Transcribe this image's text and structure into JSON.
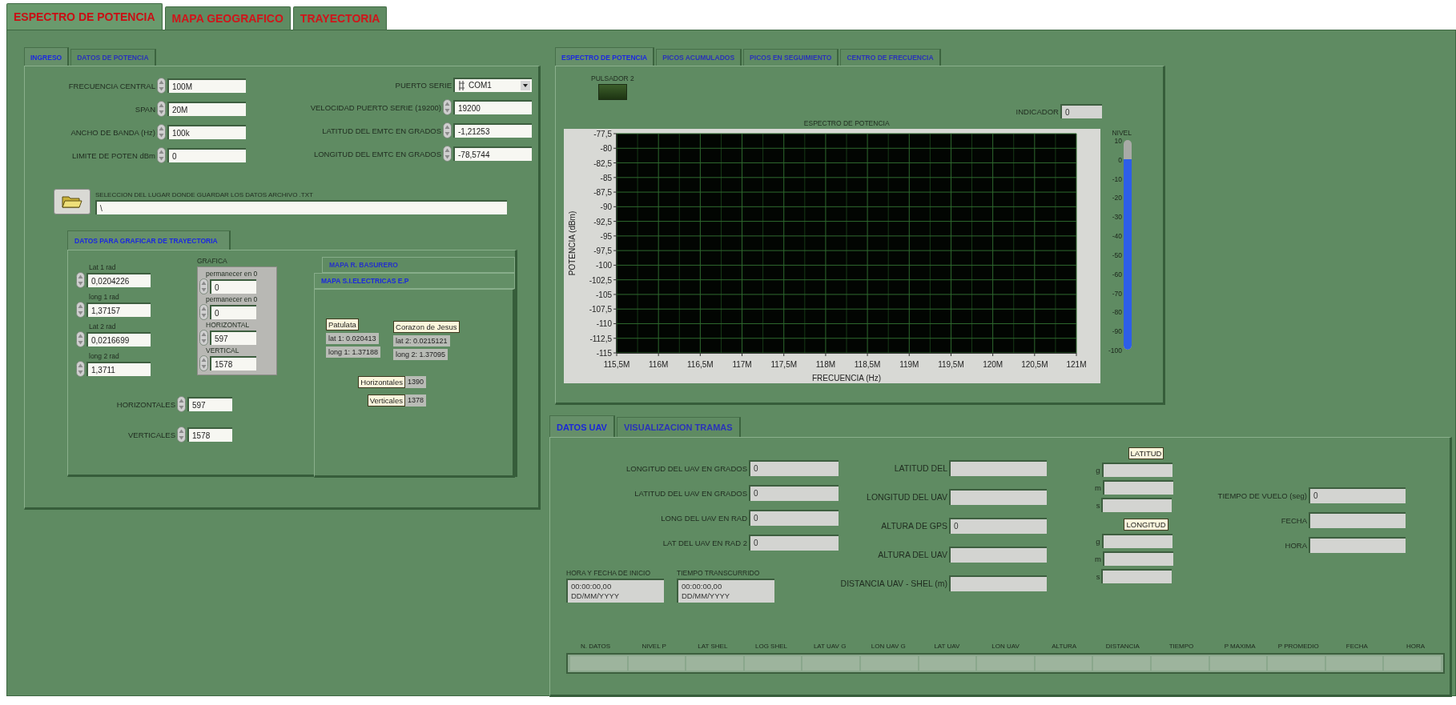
{
  "main_tabs": [
    {
      "label": "ESPECTRO DE POTENCIA",
      "selected": true
    },
    {
      "label": "MAPA GEOGRAFICO",
      "selected": false
    },
    {
      "label": "TRAYECTORIA",
      "selected": false
    }
  ],
  "input_panel": {
    "tabs": [
      {
        "label": "INGRESO",
        "selected": true
      },
      {
        "label": "DATOS DE POTENCIA",
        "selected": false
      }
    ],
    "left_fields": [
      {
        "kind": "control",
        "label": "FRECUENCIA CENTRAL",
        "value": "100M"
      },
      {
        "kind": "control",
        "label": "SPAN",
        "value": "20M"
      },
      {
        "kind": "control",
        "label": "ANCHO DE BANDA (Hz)",
        "value": "100k"
      },
      {
        "kind": "control",
        "label": "LIMITE DE POTEN dBm",
        "value": "0"
      }
    ],
    "right_fields": [
      {
        "kind": "dropdown",
        "label": "PUERTO SERIE",
        "value": "COM1"
      },
      {
        "kind": "control",
        "label": "VELOCIDAD PUERTO SERIE (19200)",
        "value": "19200"
      },
      {
        "kind": "control",
        "label": "LATITUD DEL EMTC EN GRADOS",
        "value": "-1,21253"
      },
      {
        "kind": "control",
        "label": "LONGITUD DEL EMTC EN GRADOS",
        "value": "-78,5744"
      }
    ],
    "path": {
      "label": "SELECCION DEL LUGAR DONDE  GUARDAR LOS DATOS ARCHIVO .TXT",
      "value": "\\"
    },
    "trajectory": {
      "tabs": [
        {
          "label": "DATOS PARA GRAFICAR DE TRAYECTORIA",
          "selected": true
        }
      ],
      "coords": [
        {
          "kind": "control",
          "label": "Lat 1 rad",
          "value": "0,0204226"
        },
        {
          "kind": "control",
          "label": "long 1 rad",
          "value": "1,37157"
        },
        {
          "kind": "control",
          "label": "Lat 2 rad",
          "value": "0,0216699"
        },
        {
          "kind": "control",
          "label": "long 2 rad",
          "value": "1,3711"
        }
      ],
      "grafica": {
        "label": "GRAFICA",
        "fields": [
          {
            "kind": "control",
            "label": "permanecer en 0",
            "value": "0"
          },
          {
            "kind": "control",
            "label": "permanecer en 0",
            "value": "0"
          },
          {
            "kind": "control",
            "label": "HORIZONTAL",
            "value": "597"
          },
          {
            "kind": "control",
            "label": "VERTICAL",
            "value": "1578"
          }
        ]
      },
      "totals": [
        {
          "kind": "control",
          "label": "HORIZONTALES",
          "value": "597"
        },
        {
          "kind": "control",
          "label": "VERTICALES",
          "value": "1578"
        }
      ],
      "map": {
        "tabs": [
          {
            "label": "MAPA R. BASURERO",
            "selected": false
          },
          {
            "label": "MAPA S.I.ELECTRICAS E.P",
            "selected": true
          }
        ],
        "points": [
          {
            "name": "Patulata",
            "lat": "lat 1: 0.020413",
            "long": "long 1: 1.37188"
          },
          {
            "name": "Corazon de Jesus",
            "lat": "lat 2: 0.0215121",
            "long": "long 2: 1.37095"
          }
        ],
        "counts": [
          {
            "label": "Horizontales",
            "value": "1390"
          },
          {
            "label": "Verticales",
            "value": "1378"
          }
        ]
      }
    }
  },
  "spectrum_panel": {
    "tabs": [
      {
        "label": "ESPECTRO DE POTENCIA",
        "selected": true
      },
      {
        "label": "PICOS ACUMULADOS",
        "selected": false
      },
      {
        "label": "PICOS EN SEGUIMIENTO",
        "selected": false
      },
      {
        "label": "CENTRO DE FRECUENCIA",
        "selected": false
      }
    ],
    "led": {
      "label": "PULSADOR 2",
      "on": false
    },
    "indicator": {
      "label": "INDICADOR",
      "value": "0"
    },
    "chart_data": {
      "type": "line",
      "grid": true,
      "title": "ESPECTRO DE POTENCIA",
      "xlabel": "FRECUENCIA (Hz)",
      "ylabel": "POTENCIA (dBm)",
      "xlim": [
        115.5,
        121
      ],
      "ylim": [
        -115,
        -77.5
      ],
      "xticks": [
        {
          "value": 115.5,
          "label": "115,5M"
        },
        {
          "value": 116,
          "label": "116M"
        },
        {
          "value": 116.5,
          "label": "116,5M"
        },
        {
          "value": 117,
          "label": "117M"
        },
        {
          "value": 117.5,
          "label": "117,5M"
        },
        {
          "value": 118,
          "label": "118M"
        },
        {
          "value": 118.5,
          "label": "118,5M"
        },
        {
          "value": 119,
          "label": "119M"
        },
        {
          "value": 119.5,
          "label": "119,5M"
        },
        {
          "value": 120,
          "label": "120M"
        },
        {
          "value": 120.5,
          "label": "120,5M"
        },
        {
          "value": 121,
          "label": "121M"
        }
      ],
      "yticks": [
        {
          "value": -77.5,
          "label": "-77,5"
        },
        {
          "value": -80,
          "label": "-80"
        },
        {
          "value": -82.5,
          "label": "-82,5"
        },
        {
          "value": -85,
          "label": "-85"
        },
        {
          "value": -87.5,
          "label": "-87,5"
        },
        {
          "value": -90,
          "label": "-90"
        },
        {
          "value": -92.5,
          "label": "-92,5"
        },
        {
          "value": -95,
          "label": "-95"
        },
        {
          "value": -97.5,
          "label": "-97,5"
        },
        {
          "value": -100,
          "label": "-100"
        },
        {
          "value": -102.5,
          "label": "-102,5"
        },
        {
          "value": -105,
          "label": "-105"
        },
        {
          "value": -107.5,
          "label": "-107,5"
        },
        {
          "value": -110,
          "label": "-110"
        },
        {
          "value": -112.5,
          "label": "-112,5"
        },
        {
          "value": -115,
          "label": "-115"
        }
      ]
    },
    "meter": {
      "label": "NIVEL",
      "scale": [
        "10",
        "0",
        "-10",
        "-20",
        "-30",
        "-40",
        "-50",
        "-60",
        "-70",
        "-80",
        "-90",
        "-100"
      ],
      "level": 0.91
    }
  },
  "uav_panel": {
    "tabs": [
      {
        "label": "DATOS UAV",
        "selected": true
      },
      {
        "label": "VISUALIZACION TRAMAS",
        "selected": false
      }
    ],
    "gps_fields": [
      {
        "kind": "indicator",
        "label": "LONGITUD DEL UAV EN GRADOS",
        "value": "0"
      },
      {
        "kind": "indicator",
        "label": "LATITUD DEL UAV EN GRADOS",
        "value": "0"
      },
      {
        "kind": "indicator",
        "label": "LONG DEL UAV EN RAD",
        "value": "0"
      },
      {
        "kind": "indicator",
        "label": "LAT DEL UAV EN RAD 2",
        "value": "0"
      }
    ],
    "timestamps": [
      {
        "kind": "indicator",
        "label": "HORA Y FECHA DE INICIO",
        "value": "00:00:00,00\nDD/MM/YYYY"
      },
      {
        "kind": "indicator",
        "label": "TIEMPO TRANSCURRIDO",
        "value": "00:00:00,00\nDD/MM/YYYY"
      }
    ],
    "uav_fields": [
      {
        "kind": "indicator",
        "label": "LATITUD DEL"
      },
      {
        "kind": "indicator",
        "label": "LONGITUD DEL UAV"
      },
      {
        "kind": "indicator",
        "label": "ALTURA DE GPS",
        "value": "0"
      },
      {
        "kind": "indicator",
        "label": "ALTURA DEL UAV"
      },
      {
        "kind": "indicator",
        "label": "DISTANCIA UAV - SHEL (m)"
      }
    ],
    "latitude": {
      "title": "LATITUD",
      "fields": [
        {
          "kind": "indicator",
          "label": "g"
        },
        {
          "kind": "indicator",
          "label": "m"
        },
        {
          "kind": "indicator",
          "label": "s"
        }
      ]
    },
    "longitude": {
      "title": "LONGITUD",
      "fields": [
        {
          "kind": "indicator",
          "label": "g"
        },
        {
          "kind": "indicator",
          "label": "m"
        },
        {
          "kind": "indicator",
          "label": "s"
        }
      ]
    },
    "flight_fields": [
      {
        "kind": "indicator",
        "label": "TIEMPO DE VUELO (seg)",
        "value": "0"
      },
      {
        "kind": "indicator",
        "label": "FECHA"
      },
      {
        "kind": "indicator",
        "label": "HORA"
      }
    ],
    "table": {
      "columns": [
        "N. DATOS",
        "NIVEL P",
        "LAT SHEL",
        "LOG SHEL",
        "LAT UAV G",
        "LON UAV G",
        "LAT UAV",
        "LON UAV",
        "ALTURA",
        "DISTANCIA",
        "TIEMPO",
        "P MAXIMA",
        "P PROMEDIO",
        "FECHA",
        "HORA"
      ]
    }
  }
}
